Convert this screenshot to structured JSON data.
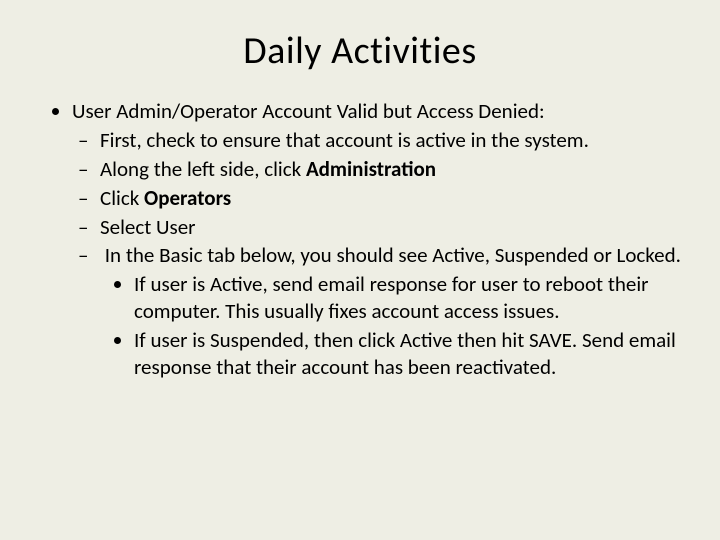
{
  "title": "Daily Activities",
  "l1": "User Admin/Operator Account Valid but Access Denied:",
  "l2_1": "First, check to ensure that account is active in the system.",
  "l2_2a": "Along the left side, click ",
  "l2_2b": "Administration",
  "l2_3a": "Click ",
  "l2_3b": "Operators",
  "l2_4": "Select User",
  "l2_5": "In the Basic tab below, you should see Active, Suspended or Locked.",
  "l3_1": "If user is Active, send email response for user to reboot their computer.  This usually fixes account access issues.",
  "l3_2": "If user is Suspended, then click Active then hit SAVE.  Send email response that their account has been reactivated."
}
